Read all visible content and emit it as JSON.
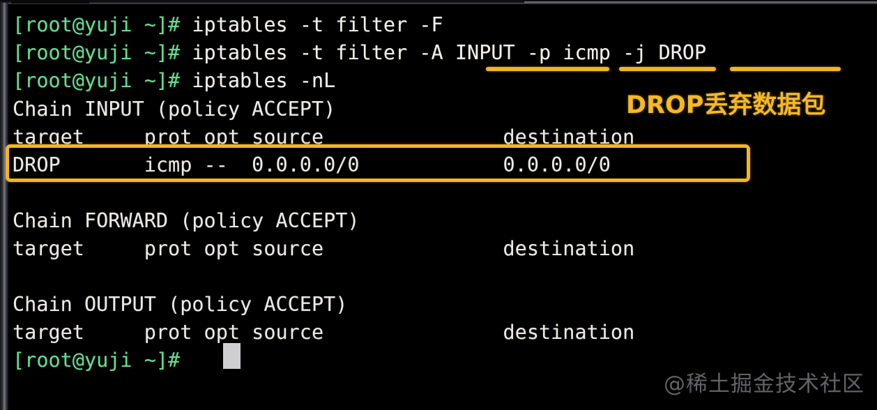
{
  "terminal": {
    "prompt": "[root@yuji ~]#",
    "lines": [
      {
        "id": "line-1",
        "type": "command",
        "prompt": "[root@yuji ~]# ",
        "text": "iptables -t filter -F"
      },
      {
        "id": "line-2",
        "type": "command",
        "prompt": "[root@yuji ~]# ",
        "text": "iptables -t filter -A INPUT -p icmp -j DROP"
      },
      {
        "id": "line-3",
        "type": "command",
        "prompt": "[root@yuji ~]# ",
        "text": "iptables -nL"
      },
      {
        "id": "line-4",
        "type": "output",
        "text": "Chain INPUT (policy ACCEPT)"
      },
      {
        "id": "line-5",
        "type": "output",
        "text": "target     prot opt source               destination"
      },
      {
        "id": "line-6",
        "type": "output",
        "text": "DROP       icmp --  0.0.0.0/0            0.0.0.0/0"
      },
      {
        "id": "line-7",
        "type": "output",
        "text": ""
      },
      {
        "id": "line-8",
        "type": "output",
        "text": "Chain FORWARD (policy ACCEPT)"
      },
      {
        "id": "line-9",
        "type": "output",
        "text": "target     prot opt source               destination"
      },
      {
        "id": "line-10",
        "type": "output",
        "text": ""
      },
      {
        "id": "line-11",
        "type": "output",
        "text": "Chain OUTPUT (policy ACCEPT)"
      },
      {
        "id": "line-12",
        "type": "output",
        "text": "target     prot opt source               destination"
      },
      {
        "id": "line-13",
        "type": "command",
        "prompt": "[root@yuji ~]# ",
        "text": ""
      }
    ],
    "cursor": "block"
  },
  "iptables_table": {
    "name": "filter",
    "chains": [
      {
        "name": "INPUT",
        "policy": "ACCEPT",
        "header": [
          "target",
          "prot",
          "opt",
          "source",
          "destination"
        ],
        "rules": [
          {
            "target": "DROP",
            "prot": "icmp",
            "opt": "--",
            "source": "0.0.0.0/0",
            "destination": "0.0.0.0/0",
            "highlighted": true
          }
        ]
      },
      {
        "name": "FORWARD",
        "policy": "ACCEPT",
        "header": [
          "target",
          "prot",
          "opt",
          "source",
          "destination"
        ],
        "rules": []
      },
      {
        "name": "OUTPUT",
        "policy": "ACCEPT",
        "header": [
          "target",
          "prot",
          "opt",
          "source",
          "destination"
        ],
        "rules": []
      }
    ]
  },
  "annotations": {
    "note_text": "DROP丢弃数据包",
    "underlined_flags": [
      "-A INPUT",
      "-p icmp",
      "-j DROP"
    ],
    "highlight_target": "DROP       icmp --  0.0.0.0/0            0.0.0.0/0",
    "accent_color": "#f3b61f"
  },
  "watermark": {
    "text": "@稀土掘金技术社区",
    "color": "#6c6c70"
  },
  "colors": {
    "background": "#000000",
    "prompt_green": "#5fe08c",
    "text_white": "#eceae4",
    "accent_yellow": "#f3b61f",
    "cursor_grey": "#cfcfd2"
  }
}
